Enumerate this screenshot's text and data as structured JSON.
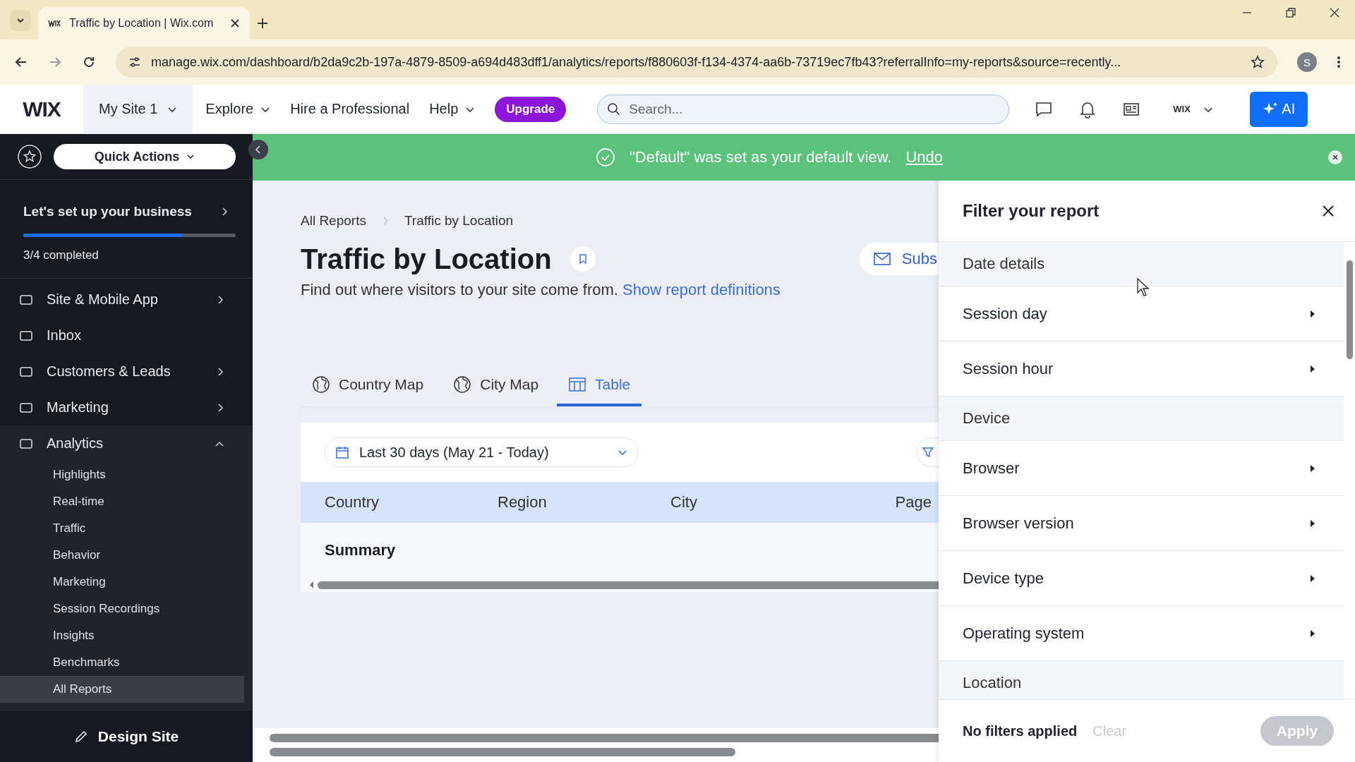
{
  "browser": {
    "tab_title": "Traffic by Location | Wix.com",
    "url": "manage.wix.com/dashboard/b2da9c2b-197a-4879-8509-a694d483dff1/analytics/reports/f880603f-f134-4374-aa6b-73719ec7fb43?referralInfo=my-reports&source=recently...",
    "profile_initial": "S"
  },
  "topbar": {
    "logo": "WIX",
    "site": "My Site 1",
    "menu": [
      {
        "label": "Explore",
        "dropdown": true
      },
      {
        "label": "Hire a Professional",
        "dropdown": false
      },
      {
        "label": "Help",
        "dropdown": true
      }
    ],
    "upgrade": "Upgrade",
    "search_placeholder": "Search...",
    "account": "WIX",
    "ai": "AI"
  },
  "sidebar": {
    "quick_actions": "Quick Actions",
    "setup": {
      "title": "Let's set up your business",
      "level": 0.75,
      "progress": "3/4 completed"
    },
    "items": [
      {
        "label": "Site & Mobile App",
        "kind": "group",
        "expanded": false
      },
      {
        "label": "Inbox",
        "kind": "link"
      },
      {
        "label": "Customers & Leads",
        "kind": "group",
        "expanded": false
      },
      {
        "label": "Marketing",
        "kind": "group",
        "expanded": false
      },
      {
        "label": "Analytics",
        "kind": "group",
        "expanded": true,
        "children": [
          {
            "label": "Highlights",
            "selected": false
          },
          {
            "label": "Real-time",
            "selected": false
          },
          {
            "label": "Traffic",
            "selected": false
          },
          {
            "label": "Behavior",
            "selected": false
          },
          {
            "label": "Marketing",
            "selected": false
          },
          {
            "label": "Session Recordings",
            "selected": false
          },
          {
            "label": "Insights",
            "selected": false
          },
          {
            "label": "Benchmarks",
            "selected": false
          },
          {
            "label": "All Reports",
            "selected": true
          }
        ]
      }
    ],
    "design_site": "Design Site"
  },
  "banner": {
    "message": "\"Default\" was set as your default view.",
    "action": "Undo"
  },
  "breadcrumb": [
    "All Reports",
    "Traffic by Location"
  ],
  "title": "Traffic by Location",
  "description": "Find out where visitors to your site come from.",
  "definitions_link": "Show report definitions",
  "subscribe": "Subs",
  "tabs": [
    {
      "label": "Country Map",
      "kind": "map",
      "selected": false
    },
    {
      "label": "City Map",
      "kind": "map",
      "selected": false
    },
    {
      "label": "Table",
      "kind": "table",
      "selected": true
    }
  ],
  "date_range": "Last 30 days (May 21 - Today)",
  "table": {
    "columns": [
      "Country",
      "Region",
      "City",
      "Page"
    ],
    "rows": [
      {
        "label": "Summary"
      }
    ]
  },
  "filter_panel": {
    "title": "Filter your report",
    "items": [
      {
        "label": "Date details",
        "kind": "header"
      },
      {
        "label": "Session day",
        "kind": "option"
      },
      {
        "label": "Session hour",
        "kind": "option"
      },
      {
        "label": "Device",
        "kind": "header"
      },
      {
        "label": "Browser",
        "kind": "option"
      },
      {
        "label": "Browser version",
        "kind": "option"
      },
      {
        "label": "Device type",
        "kind": "option"
      },
      {
        "label": "Operating system",
        "kind": "option"
      },
      {
        "label": "Location",
        "kind": "header"
      }
    ],
    "status": "No filters applied",
    "clear": {
      "label": "Clear",
      "disabled": true
    },
    "apply": {
      "label": "Apply",
      "disabled": true
    }
  }
}
